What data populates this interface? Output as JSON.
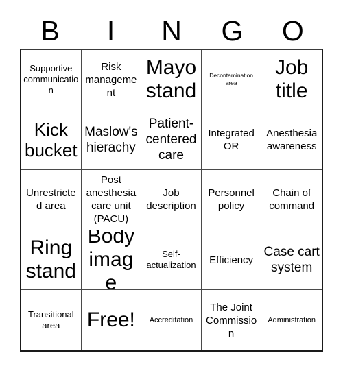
{
  "card": {
    "header_letters": [
      "B",
      "I",
      "N",
      "G",
      "O"
    ],
    "free_space_label": "Free!",
    "grid_size": 5,
    "colors": {
      "background": "#ffffff",
      "text": "#000000",
      "grid_line": "#4a4a4a",
      "grid_outline": "#1a1a1a"
    },
    "cells": [
      {
        "text": "Supportive communication",
        "size": "sm",
        "column": "B",
        "row": 1
      },
      {
        "text": "Risk management",
        "size": "md",
        "column": "I",
        "row": 1
      },
      {
        "text": "Mayo stand",
        "size": "xxl",
        "column": "N",
        "row": 1
      },
      {
        "text": "Decontamination area",
        "size": "xxs",
        "column": "G",
        "row": 1
      },
      {
        "text": "Job title",
        "size": "xxl",
        "column": "O",
        "row": 1
      },
      {
        "text": "Kick bucket",
        "size": "xl",
        "column": "B",
        "row": 2
      },
      {
        "text": "Maslow's hierachy",
        "size": "lg",
        "column": "I",
        "row": 2
      },
      {
        "text": "Patient-centered care",
        "size": "lg",
        "column": "N",
        "row": 2
      },
      {
        "text": "Integrated OR",
        "size": "md",
        "column": "G",
        "row": 2
      },
      {
        "text": "Anesthesia awareness",
        "size": "md",
        "column": "O",
        "row": 2
      },
      {
        "text": "Unrestricted area",
        "size": "md",
        "column": "B",
        "row": 3
      },
      {
        "text": "Post anesthesia care unit (PACU)",
        "size": "md",
        "column": "I",
        "row": 3
      },
      {
        "text": "Job description",
        "size": "md",
        "column": "N",
        "row": 3
      },
      {
        "text": "Personnel policy",
        "size": "md",
        "column": "G",
        "row": 3
      },
      {
        "text": "Chain of command",
        "size": "md",
        "column": "O",
        "row": 3
      },
      {
        "text": "Ring stand",
        "size": "xxl",
        "column": "B",
        "row": 4
      },
      {
        "text": "Body image",
        "size": "xxl",
        "column": "I",
        "row": 4
      },
      {
        "text": "Self-actualization",
        "size": "sm",
        "column": "N",
        "row": 4
      },
      {
        "text": "Efficiency",
        "size": "md",
        "column": "G",
        "row": 4
      },
      {
        "text": "Case cart system",
        "size": "lg",
        "column": "O",
        "row": 4
      },
      {
        "text": "Transitional area",
        "size": "sm",
        "column": "B",
        "row": 5
      },
      {
        "text": "Free!",
        "size": "xxl",
        "column": "I",
        "row": 5
      },
      {
        "text": "Accreditation",
        "size": "xs",
        "column": "N",
        "row": 5
      },
      {
        "text": "The Joint Commission",
        "size": "md",
        "column": "G",
        "row": 5
      },
      {
        "text": "Administration",
        "size": "xs",
        "column": "O",
        "row": 5
      }
    ]
  }
}
